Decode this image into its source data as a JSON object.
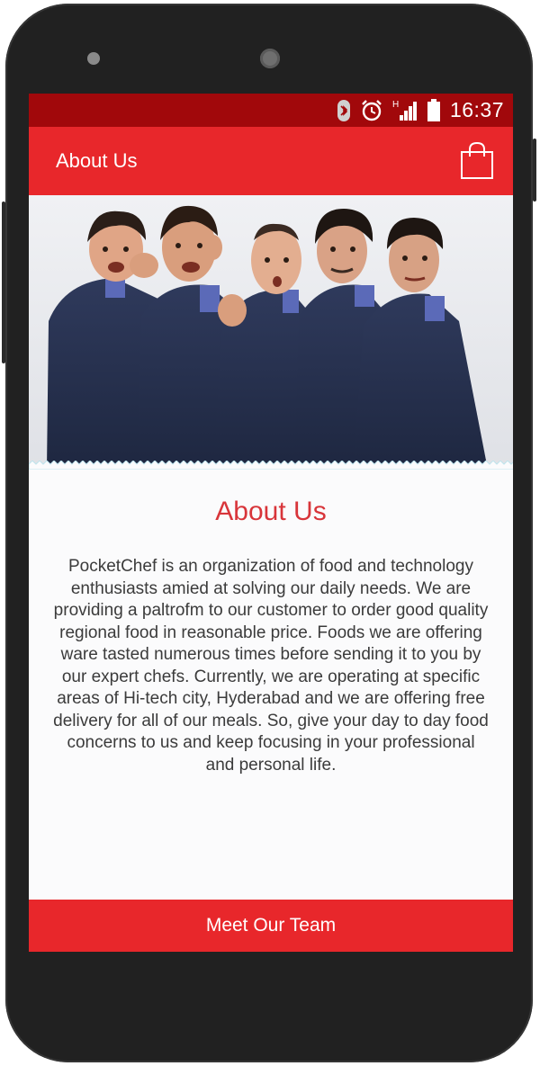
{
  "status_bar": {
    "time": "16:37",
    "icons": [
      "bluetooth-icon",
      "alarm-icon",
      "signal-icon",
      "battery-icon"
    ],
    "color": "#a1080b"
  },
  "app_bar": {
    "title": "About Us",
    "action_icon": "shopping-bag-icon",
    "color": "#e8272b"
  },
  "content": {
    "heading": "About Us",
    "body": "PocketChef is an organization of food and technology enthusiasts amied at solving our daily needs. We are providing a paltrofm to our customer to order good quality regional food in reasonable price. Foods we are offering ware tasted numerous times before sending it to you by our expert chefs. Currently, we are operating at specific areas of Hi-tech city, Hyderabad and we are offering free delivery for all of our meals. So, give your day to day food concerns to us and keep focusing in your professional and personal life.",
    "heading_color": "#d8353a"
  },
  "cta": {
    "label": "Meet Our Team"
  },
  "hero": {
    "subject": "team-photo"
  }
}
